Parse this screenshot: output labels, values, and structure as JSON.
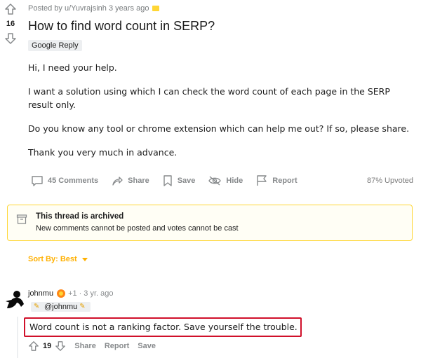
{
  "post": {
    "score": "16",
    "meta": "Posted by u/Yuvrajsinh 3 years ago",
    "title": "How to find word count in SERP?",
    "flair": "Google Reply",
    "body": [
      "Hi, I need your help.",
      "I want a solution using which I can check the word count of each page in the SERP result only.",
      "Do you know any tool or chrome extension which can help me out? If so, please share.",
      "Thank you very much in advance."
    ],
    "actions": {
      "comments": "45 Comments",
      "share": "Share",
      "save": "Save",
      "hide": "Hide",
      "report": "Report",
      "upvoted": "87% Upvoted"
    }
  },
  "archived": {
    "title": "This thread is archived",
    "message": "New comments cannot be posted and votes cannot be cast"
  },
  "sort": {
    "label": "Sort By: Best"
  },
  "comment": {
    "user": "johnmu",
    "karma": "+1",
    "separator": "·",
    "time": "3 yr. ago",
    "flair_handle": "@johnmu",
    "text": "Word count is not a ranking factor. Save yourself the trouble.",
    "score": "19",
    "share": "Share",
    "report": "Report",
    "save": "Save"
  },
  "colors": {
    "accent_yellow": "#ffd635",
    "sort_orange": "#ffb000",
    "highlight_red": "#d0102a"
  }
}
